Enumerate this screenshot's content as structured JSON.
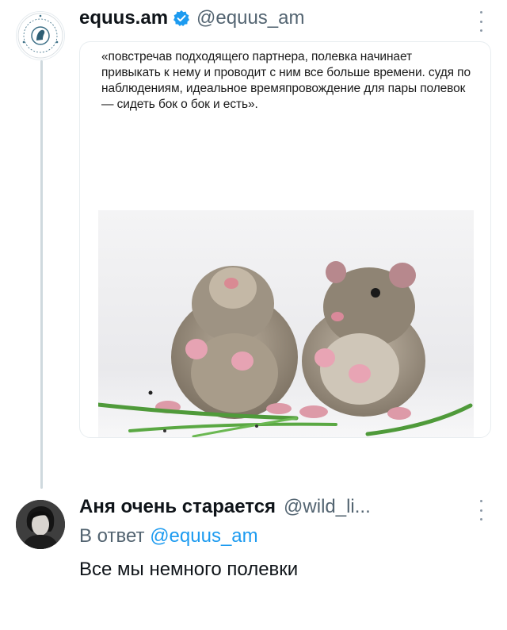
{
  "original_tweet": {
    "author_name": "equus.am",
    "author_handle": "@equus_am",
    "avatar_text": "ԷՎՈԼՈՒ · EQUUS · ԵՔՎՈՒՍ",
    "quoted_text": "«повстречав подходящего партнера, полевка начинает привыкать к нему и проводит с ним все больше времени. судя по наблюдениям, идеальное времяпровождение для пары полевок — сидеть бок о бок и есть».",
    "image_subject": "two-hamsters"
  },
  "reply_tweet": {
    "author_name": "Аня очень старается",
    "author_handle": "@wild_li...",
    "reply_prefix": "В ответ",
    "reply_mention": "@equus_am",
    "text": "Все мы немного полевки"
  },
  "colors": {
    "accent": "#1d9bf0",
    "secondary_text": "#536471",
    "primary_text": "#0f1419",
    "thread_line": "#cfd9de"
  }
}
